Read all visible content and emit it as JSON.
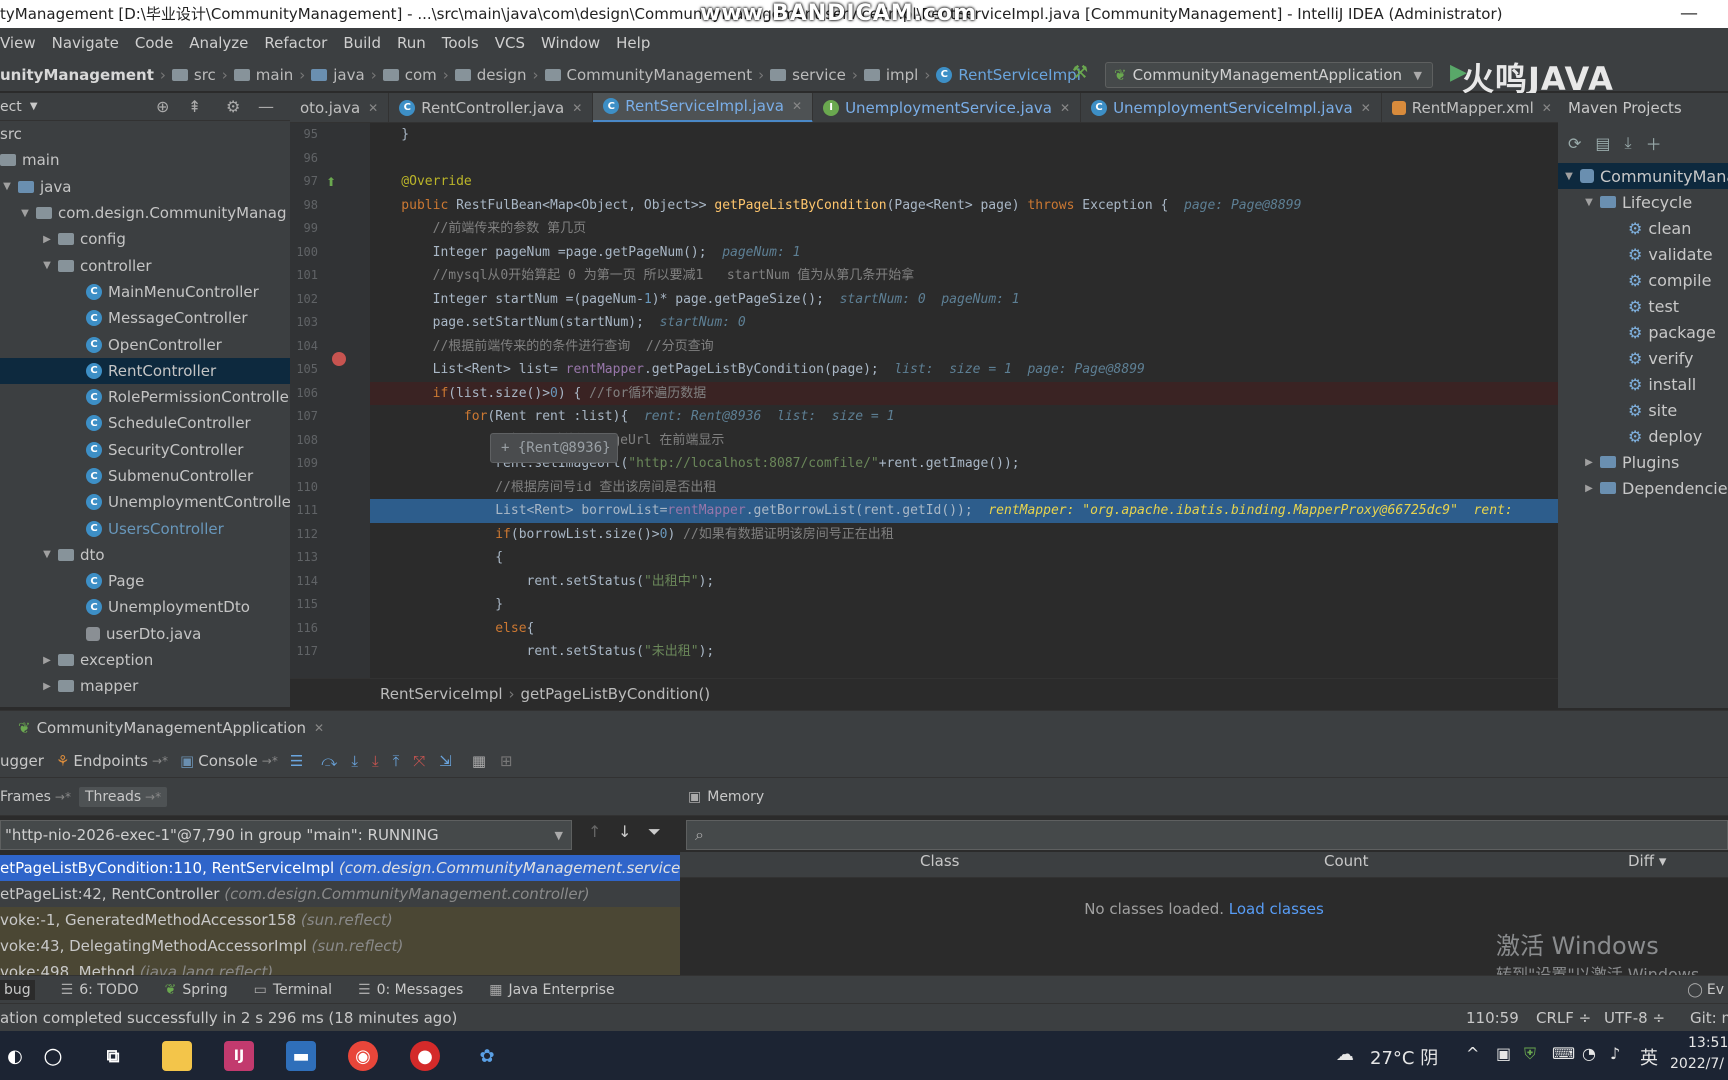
{
  "window": {
    "title": "tyManagement [D:\\毕业设计\\CommunityManagement] - ...\\src\\main\\java\\com\\design\\CommunityManagement\\service\\impl\\RentServiceImpl.java [CommunityManagement] - IntelliJ IDEA (Administrator)",
    "watermark": "www.BANDICAM.com",
    "minimize": "—"
  },
  "menu": [
    "View",
    "Navigate",
    "Code",
    "Analyze",
    "Refactor",
    "Build",
    "Run",
    "Tools",
    "VCS",
    "Window",
    "Help"
  ],
  "navbar": {
    "crumbs": [
      "unityManagement",
      "src",
      "main",
      "java",
      "com",
      "design",
      "CommunityManagement",
      "service",
      "impl",
      "RentServiceImpl"
    ],
    "run_config": "CommunityManagementApplication",
    "brand": "火鸣JAVA"
  },
  "project": {
    "header": "ect",
    "tree": [
      {
        "label": "src",
        "indent": 0
      },
      {
        "label": "main",
        "indent": 1
      },
      {
        "label": "java",
        "indent": 2
      },
      {
        "label": "com.design.CommunityManag",
        "indent": 3
      },
      {
        "label": "config",
        "indent": 4
      },
      {
        "label": "controller",
        "indent": 4
      },
      {
        "label": "MainMenuController",
        "indent": 5
      },
      {
        "label": "MessageController",
        "indent": 5
      },
      {
        "label": "OpenController",
        "indent": 5
      },
      {
        "label": "RentController",
        "indent": 5
      },
      {
        "label": "RolePermissionControlle",
        "indent": 5
      },
      {
        "label": "ScheduleController",
        "indent": 5
      },
      {
        "label": "SecurityController",
        "indent": 5
      },
      {
        "label": "SubmenuController",
        "indent": 5
      },
      {
        "label": "UnemploymentControlle",
        "indent": 5
      },
      {
        "label": "UsersController",
        "indent": 5
      },
      {
        "label": "dto",
        "indent": 4
      },
      {
        "label": "Page",
        "indent": 5
      },
      {
        "label": "UnemploymentDto",
        "indent": 5
      },
      {
        "label": "userDto.java",
        "indent": 5
      },
      {
        "label": "exception",
        "indent": 4
      },
      {
        "label": "mapper",
        "indent": 4
      }
    ]
  },
  "tabs": [
    "oto.java",
    "RentController.java",
    "RentServiceImpl.java",
    "UnemploymentService.java",
    "UnemploymentServiceImpl.java",
    "RentMapper.xml"
  ],
  "editor": {
    "line_numbers": [
      "95",
      "96",
      "97",
      "98",
      "99",
      "100",
      "101",
      "102",
      "103",
      "104",
      "105",
      "106",
      "107",
      "108",
      "109",
      "110",
      "111",
      "112",
      "113",
      "114",
      "115",
      "116",
      "117"
    ],
    "tooltip": "+ {Rent@8936}",
    "breadcrumb": [
      "RentServiceImpl",
      "getPageListByCondition()"
    ]
  },
  "maven": {
    "title": "Maven Projects",
    "root": "CommunityMana",
    "lifecycle": "Lifecycle",
    "goals": [
      "clean",
      "validate",
      "compile",
      "test",
      "package",
      "verify",
      "install",
      "site",
      "deploy"
    ],
    "plugins": "Plugins",
    "dependencies": "Dependencie"
  },
  "run": {
    "app": "CommunityManagementApplication",
    "tabs": [
      "ugger",
      "Endpoints",
      "Console"
    ],
    "frames_tab": "Frames",
    "threads_tab": "Threads",
    "thread": "\"http-nio-2026-exec-1\"@7,790 in group \"main\": RUNNING",
    "frames": [
      {
        "method": "etPageListByCondition:110, RentServiceImpl",
        "pkg": "(com.design.CommunityManagement.service.im"
      },
      {
        "method": "etPageList:42, RentController",
        "pkg": "(com.design.CommunityManagement.controller)"
      },
      {
        "method": "voke:-1, GeneratedMethodAccessor158",
        "pkg": "(sun.reflect)"
      },
      {
        "method": "voke:43, DelegatingMethodAccessorImpl",
        "pkg": "(sun.reflect)"
      },
      {
        "method": "voke:498, Method",
        "pkg": "(java.lang.reflect)"
      }
    ],
    "memory_title": "Memory",
    "memory_cols": [
      "Class",
      "Count",
      "Diff ▾"
    ],
    "no_classes": "No classes loaded.",
    "load_classes": "Load classes"
  },
  "activate": {
    "line1": "激活 Windows",
    "line2": "转到\"设置\"以激活 Windows。"
  },
  "toolstrip": [
    "bug",
    "6: TODO",
    "Spring",
    "Terminal",
    "0: Messages",
    "Java Enterprise"
  ],
  "toolstrip_right": "Ev",
  "status": {
    "message": "ation completed successfully in 2 s 296 ms (18 minutes ago)",
    "position": "110:59",
    "line_sep": "CRLF ÷",
    "encoding": "UTF-8 ÷",
    "git": "Git: mast"
  },
  "taskbar": {
    "weather": "27°C 阴",
    "ime": "英",
    "time": "13:51",
    "date": "2022/7/"
  },
  "colors": {
    "accent": "#4a88c7",
    "selection": "#2f65ca",
    "breakpoint": "#c75450"
  }
}
